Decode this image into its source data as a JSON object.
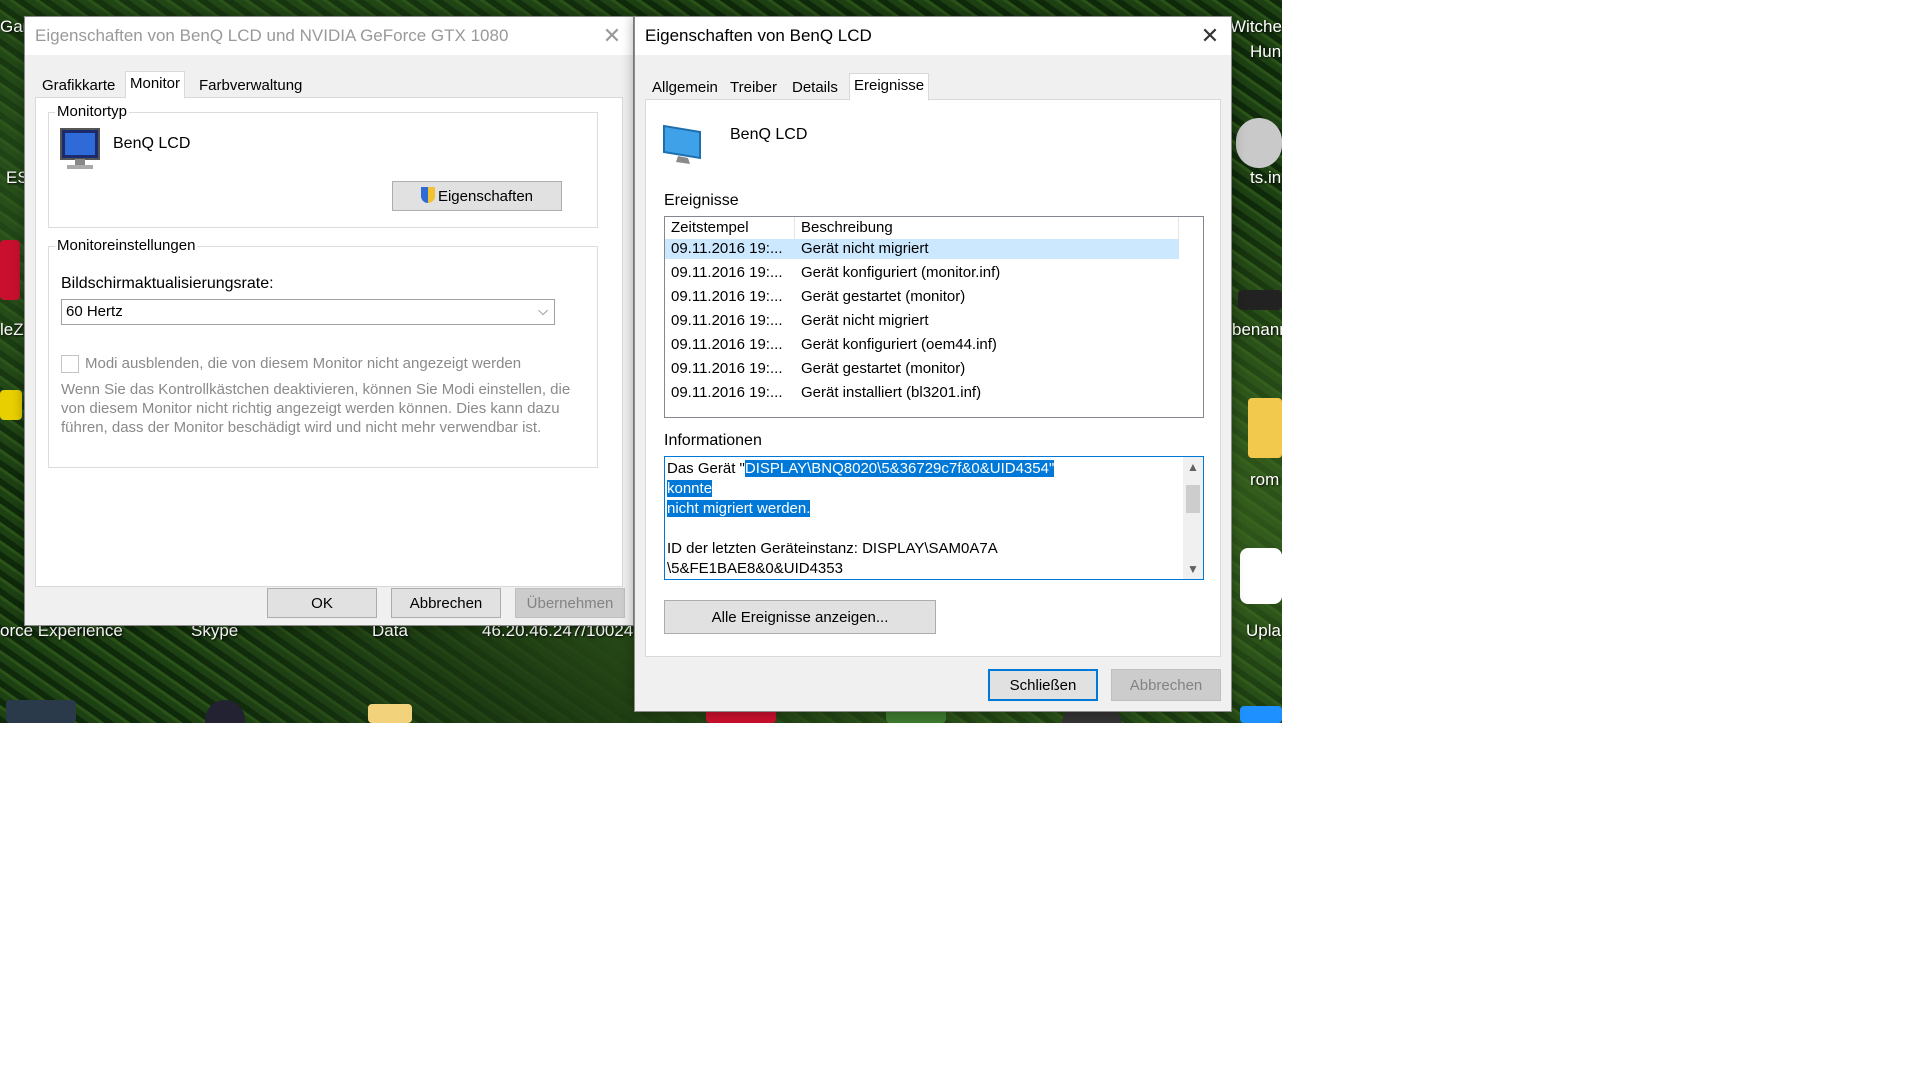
{
  "desktop": {
    "labels": [
      "orce Experience",
      "Skype",
      "Data",
      "46.20.46.247/10024",
      "Witche",
      "Hun",
      "ts.in",
      "benann",
      "rom",
      "Upla",
      "Gan",
      "ES",
      "leZ"
    ]
  },
  "left_dialog": {
    "title": "Eigenschaften von BenQ LCD und NVIDIA GeForce GTX 1080",
    "tabs": [
      "Grafikkarte",
      "Monitor",
      "Farbverwaltung"
    ],
    "active_tab": "Monitor",
    "monitortyp": {
      "legend": "Monitortyp",
      "monitor_name": "BenQ LCD",
      "properties_button": "Eigenschaften"
    },
    "settings": {
      "legend": "Monitoreinstellungen",
      "refresh_label": "Bildschirmaktualisierungsrate:",
      "refresh_value": "60 Hertz",
      "hide_modes_label": "Modi ausblenden, die von diesem Monitor nicht angezeigt werden",
      "hide_modes_checked": false,
      "warning": "Wenn Sie das Kontrollkästchen deaktivieren, können Sie Modi einstellen, die von diesem Monitor nicht richtig angezeigt werden können. Dies kann dazu führen, dass der Monitor beschädigt wird und nicht mehr verwendbar ist."
    },
    "buttons": {
      "ok": "OK",
      "cancel": "Abbrechen",
      "apply": "Übernehmen"
    }
  },
  "right_dialog": {
    "title": "Eigenschaften von BenQ LCD",
    "tabs": [
      "Allgemein",
      "Treiber",
      "Details",
      "Ereignisse"
    ],
    "active_tab": "Ereignisse",
    "device_name": "BenQ LCD",
    "events_label": "Ereignisse",
    "columns": [
      "Zeitstempel",
      "Beschreibung"
    ],
    "rows": [
      {
        "time": "09.11.2016 19:...",
        "desc": "Gerät nicht migriert"
      },
      {
        "time": "09.11.2016 19:...",
        "desc": "Gerät konfiguriert (monitor.inf)"
      },
      {
        "time": "09.11.2016 19:...",
        "desc": "Gerät gestartet (monitor)"
      },
      {
        "time": "09.11.2016 19:...",
        "desc": "Gerät nicht migriert"
      },
      {
        "time": "09.11.2016 19:...",
        "desc": "Gerät konfiguriert (oem44.inf)"
      },
      {
        "time": "09.11.2016 19:...",
        "desc": "Gerät gestartet (monitor)"
      },
      {
        "time": "09.11.2016 19:...",
        "desc": "Gerät installiert (bl3201.inf)"
      }
    ],
    "selected_row": 0,
    "info_label": "Informationen",
    "info": {
      "prefix": "Das Gerät \"",
      "highlight_line1": "DISPLAY\\BNQ8020\\5&36729c7f&0&UID4354\" konnte",
      "highlight_line2": "nicht migriert werden.",
      "line3": "ID der letzten Geräteinstanz: DISPLAY\\SAM0A7A",
      "line4": "\\5&FE1BAE8&0&UID4353"
    },
    "all_events_button": "Alle Ereignisse anzeigen...",
    "buttons": {
      "close": "Schließen",
      "cancel": "Abbrechen"
    }
  },
  "colors": {
    "accent": "#0078d7",
    "selection": "#cce8ff",
    "dialog_bg": "#f0f0f0"
  }
}
